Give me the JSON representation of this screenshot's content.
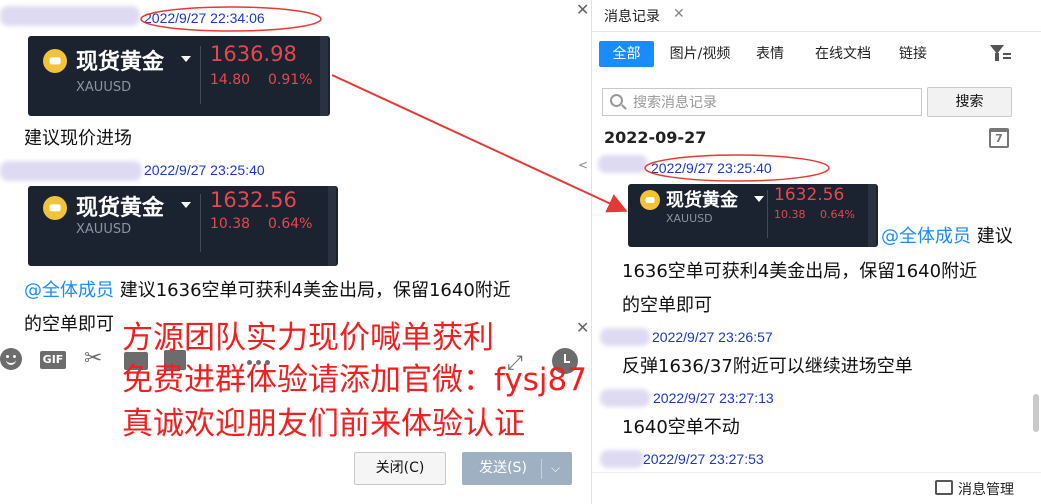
{
  "left_chat": {
    "messages": [
      {
        "timestamp": "2022/9/27 22:34:06"
      },
      {
        "text": "建议现价进场"
      },
      {
        "timestamp": "2022/9/27 23:25:40"
      },
      {
        "mention": "@全体成员",
        "text": " 建议1636空单可获利4美金出局，保留1640附近",
        "text2": "的空单即可"
      }
    ]
  },
  "ticker_cards": [
    {
      "name": "现货黄金",
      "symbol": "XAUUSD",
      "price": "1636.98",
      "change": "14.80",
      "change_pct": "0.91%"
    },
    {
      "name": "现货黄金",
      "symbol": "XAUUSD",
      "price": "1632.56",
      "change": "10.38",
      "change_pct": "0.64%"
    }
  ],
  "toolbar": {
    "gif_label": "GIF"
  },
  "buttons": {
    "close": "关闭(C)",
    "send": "发送(S)"
  },
  "overlay_text": {
    "line1": "方源团队实力现价喊单获利",
    "line2": "免费进群体验请添加官微：fysj87",
    "line3": "真诚欢迎朋友们前来体验认证"
  },
  "history": {
    "tab_title": "消息记录",
    "filters": [
      "全部",
      "图片/视频",
      "表情",
      "在线文档",
      "链接"
    ],
    "search_placeholder": "搜索消息记录",
    "search_button": "搜索",
    "date": "2022-09-27",
    "calendar_day": "7",
    "card": {
      "name": "现货黄金",
      "symbol": "XAUUSD",
      "price": "1632.56",
      "change": "10.38",
      "change_pct": "0.64%"
    },
    "entries": [
      {
        "timestamp": "2022/9/27 23:25:40",
        "mention": "@全体成员",
        "text_a": " 建议",
        "text_b": "1636空单可获利4美金出局，保留1640附近",
        "text_c": "的空单即可"
      },
      {
        "timestamp": "2022/9/27 23:26:57",
        "text": "反弹1636/37附近可以继续进场空单"
      },
      {
        "timestamp": "2022/9/27 23:27:13",
        "text": "1640空单不动"
      },
      {
        "timestamp": "2022/9/27 23:27:53"
      }
    ],
    "manage_label": "消息管理"
  },
  "colors": {
    "accent": "#1a8cff",
    "annotation": "#f02020",
    "timestamp": "#1d39c4",
    "card_bg": "#1b2230"
  }
}
